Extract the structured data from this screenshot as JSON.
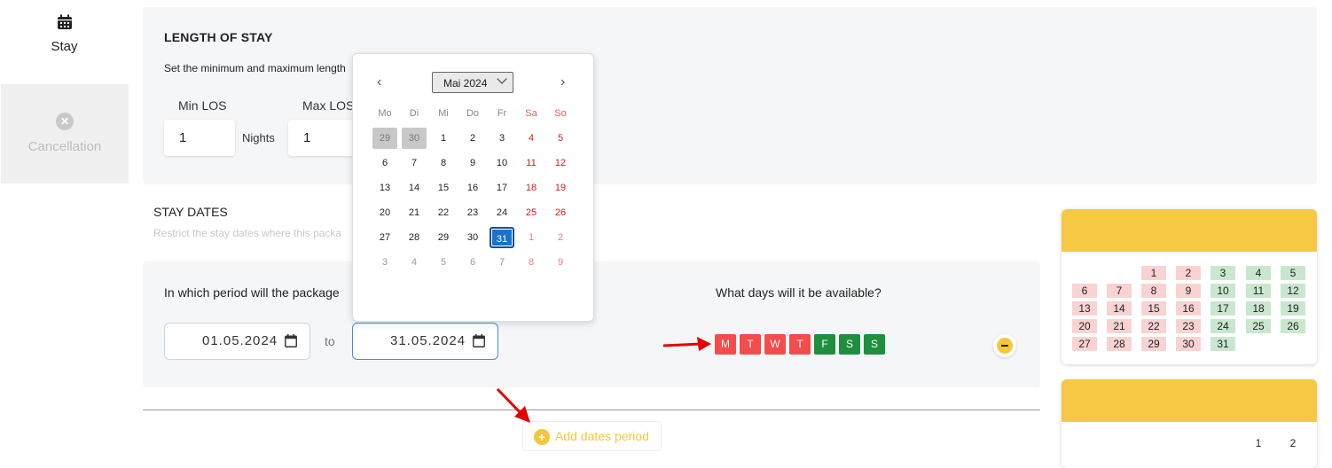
{
  "nav": {
    "stay_label": "Stay",
    "cancellation_label": "Cancellation"
  },
  "los": {
    "title": "LENGTH OF STAY",
    "subtitle": "Set the minimum and maximum length",
    "min_label": "Min LOS",
    "max_label": "Max LOS",
    "min_value": "1",
    "max_value": "1",
    "nights_label": "Nights"
  },
  "stay_dates": {
    "title": "STAY DATES",
    "subtitle": "Restrict the stay dates where this packa",
    "period_question": "In which period will the package",
    "days_question": "What days will it be available?",
    "from_date": "01.05.2024",
    "to_label": "to",
    "to_date": "31.05.2024",
    "weekdays": [
      {
        "label": "M",
        "available": false
      },
      {
        "label": "T",
        "available": false
      },
      {
        "label": "W",
        "available": false
      },
      {
        "label": "T",
        "available": false
      },
      {
        "label": "F",
        "available": true
      },
      {
        "label": "S",
        "available": true
      },
      {
        "label": "S",
        "available": true
      }
    ],
    "add_period_label": "Add dates period"
  },
  "datepicker": {
    "month_label": "Mai 2024",
    "weekday_headers": [
      "Mo",
      "Di",
      "Mi",
      "Do",
      "Fr",
      "Sa",
      "So"
    ],
    "weeks": [
      [
        "29",
        "30",
        "1",
        "2",
        "3",
        "4",
        "5"
      ],
      [
        "6",
        "7",
        "8",
        "9",
        "10",
        "11",
        "12"
      ],
      [
        "13",
        "14",
        "15",
        "16",
        "17",
        "18",
        "19"
      ],
      [
        "20",
        "21",
        "22",
        "23",
        "24",
        "25",
        "26"
      ],
      [
        "27",
        "28",
        "29",
        "30",
        "31",
        "1",
        "2"
      ],
      [
        "3",
        "4",
        "5",
        "6",
        "7",
        "8",
        "9"
      ]
    ],
    "selected": "31"
  },
  "mini_calendar_1": {
    "rows": [
      [
        "",
        "",
        "1",
        "2",
        "3",
        "4",
        "5"
      ],
      [
        "6",
        "7",
        "8",
        "9",
        "10",
        "11",
        "12"
      ],
      [
        "13",
        "14",
        "15",
        "16",
        "17",
        "18",
        "19"
      ],
      [
        "20",
        "21",
        "22",
        "23",
        "24",
        "25",
        "26"
      ],
      [
        "27",
        "28",
        "29",
        "30",
        "31",
        "",
        ""
      ]
    ]
  },
  "mini_calendar_2": {
    "visible_days": [
      "1",
      "2"
    ]
  },
  "colors": {
    "accent_yellow": "#f7c843",
    "unavailable_red": "#f44b4b",
    "available_green": "#1e8f3e",
    "selected_blue": "#1a72c9"
  }
}
